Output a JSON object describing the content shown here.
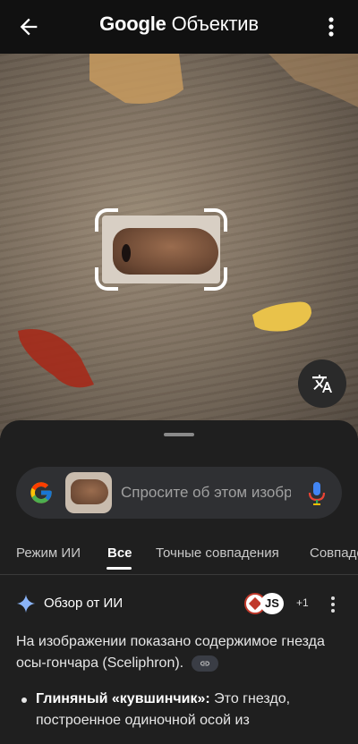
{
  "app": {
    "title_brand": "Google",
    "title_product": "Объектив"
  },
  "icons": {
    "back": "arrow-left-icon",
    "menu": "more-vert-icon",
    "translate": "translate-icon",
    "google": "google-g-icon",
    "mic": "microphone-icon",
    "spark": "ai-spark-icon",
    "link": "link-icon"
  },
  "search": {
    "placeholder": "Спросите об этом изображении"
  },
  "tabs": [
    {
      "label": "Режим ИИ"
    },
    {
      "label": "Все"
    },
    {
      "label": "Точные совпадения"
    },
    {
      "label": "Совпадения"
    }
  ],
  "ai_overview": {
    "title": "Обзор от ИИ",
    "sources_more": "+1",
    "source2_text": "JS",
    "summary": "На изображении показано содержимое гнезда осы-гончара (Sceliphron).",
    "bullet_bold": "Глиняный «кувшинчик»:",
    "bullet_text": " Это гнездо, построенное одиночной осой из"
  },
  "colors": {
    "accent_blue": "#8ab4f8",
    "background": "#1f1f1f",
    "top_bar": "#111111"
  }
}
